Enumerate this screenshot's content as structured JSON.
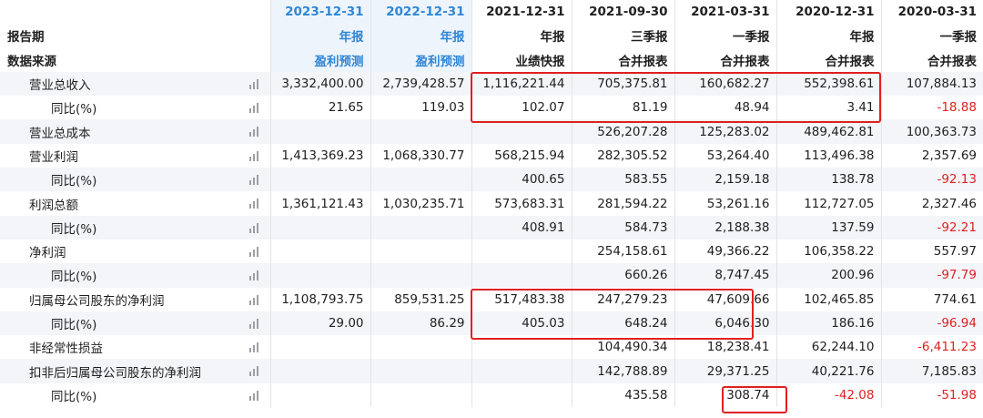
{
  "header": {
    "dates": [
      "2023-12-31",
      "2022-12-31",
      "2021-12-31",
      "2021-09-30",
      "2021-03-31",
      "2020-12-31",
      "2020-03-31"
    ],
    "report_period_label": "报告期",
    "periods": [
      "年报",
      "年报",
      "年报",
      "三季报",
      "一季报",
      "年报",
      "一季报"
    ],
    "data_source_label": "数据来源",
    "sources": [
      "盈利预测",
      "盈利预测",
      "业绩快报",
      "合并报表",
      "合并报表",
      "合并报表",
      "合并报表"
    ]
  },
  "rows": [
    {
      "label": "营业总收入",
      "values": [
        "3,332,400.00",
        "2,739,428.57",
        "1,116,221.44",
        "705,375.81",
        "160,682.27",
        "552,398.61",
        "107,884.13"
      ]
    },
    {
      "label": "同比(%)",
      "values": [
        "21.65",
        "119.03",
        "102.07",
        "81.19",
        "48.94",
        "3.41",
        "-18.88"
      ]
    },
    {
      "label": "营业总成本",
      "values": [
        "",
        "",
        "",
        "526,207.28",
        "125,283.02",
        "489,462.81",
        "100,363.73"
      ]
    },
    {
      "label": "营业利润",
      "values": [
        "1,413,369.23",
        "1,068,330.77",
        "568,215.94",
        "282,305.52",
        "53,264.40",
        "113,496.38",
        "2,357.69"
      ]
    },
    {
      "label": "同比(%)",
      "values": [
        "",
        "",
        "400.65",
        "583.55",
        "2,159.18",
        "138.78",
        "-92.13"
      ]
    },
    {
      "label": "利润总额",
      "values": [
        "1,361,121.43",
        "1,030,235.71",
        "573,683.31",
        "281,594.22",
        "53,261.16",
        "112,727.05",
        "2,327.46"
      ]
    },
    {
      "label": "同比(%)",
      "values": [
        "",
        "",
        "408.91",
        "584.73",
        "2,188.38",
        "137.59",
        "-92.21"
      ]
    },
    {
      "label": "净利润",
      "values": [
        "",
        "",
        "",
        "254,158.61",
        "49,366.22",
        "106,358.22",
        "557.97"
      ]
    },
    {
      "label": "同比(%)",
      "values": [
        "",
        "",
        "",
        "660.26",
        "8,747.45",
        "200.96",
        "-97.79"
      ]
    },
    {
      "label": "归属母公司股东的净利润",
      "values": [
        "1,108,793.75",
        "859,531.25",
        "517,483.38",
        "247,279.23",
        "47,609.66",
        "102,465.85",
        "774.61"
      ]
    },
    {
      "label": "同比(%)",
      "values": [
        "29.00",
        "86.29",
        "405.03",
        "648.24",
        "6,046.30",
        "186.16",
        "-96.94"
      ]
    },
    {
      "label": "非经常性损益",
      "values": [
        "",
        "",
        "",
        "104,490.34",
        "18,238.41",
        "62,244.10",
        "-6,411.23"
      ]
    },
    {
      "label": "扣非后归属母公司股东的净利润",
      "values": [
        "",
        "",
        "",
        "142,788.89",
        "29,371.25",
        "40,221.76",
        "7,185.83"
      ]
    },
    {
      "label": "同比(%)",
      "values": [
        "",
        "",
        "",
        "435.58",
        "308.74",
        "-42.08",
        "-51.98"
      ]
    }
  ],
  "colors": {
    "accent": "#2f86d6",
    "negative": "#e02020",
    "highlight_box": "#e02020"
  }
}
